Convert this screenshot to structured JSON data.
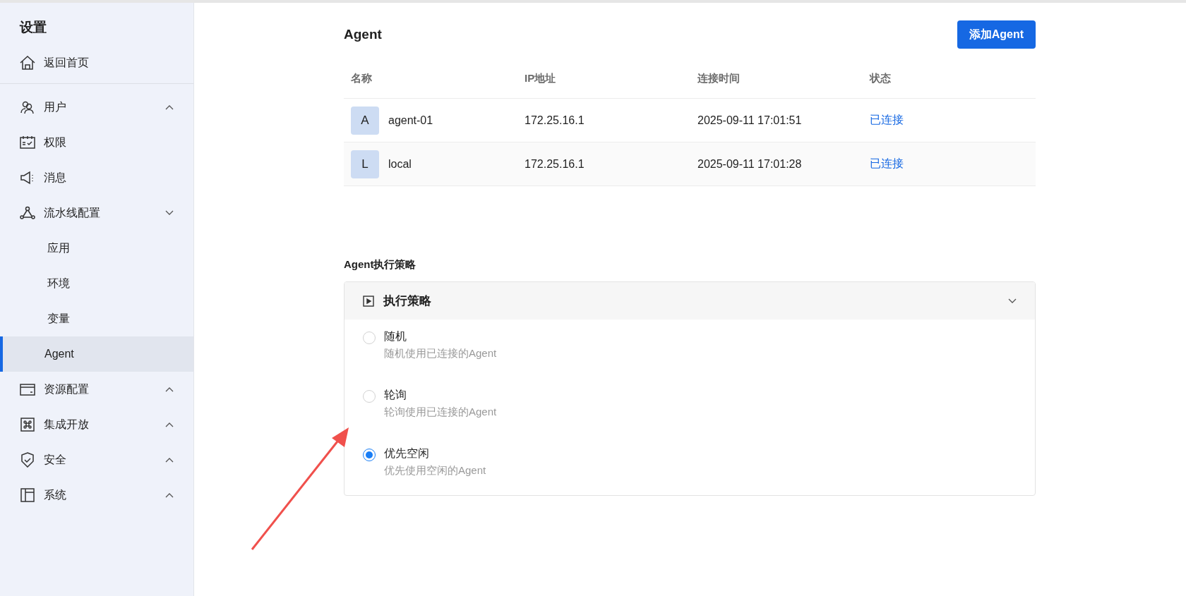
{
  "sidebar": {
    "title": "设置",
    "home": "返回首页",
    "items": [
      {
        "label": "用户",
        "expanded": false
      },
      {
        "label": "权限"
      },
      {
        "label": "消息"
      },
      {
        "label": "流水线配置",
        "expanded": true,
        "children": [
          {
            "label": "应用",
            "selected": false
          },
          {
            "label": "环境",
            "selected": false
          },
          {
            "label": "变量",
            "selected": false
          },
          {
            "label": "Agent",
            "selected": true
          }
        ]
      },
      {
        "label": "资源配置",
        "expanded": false
      },
      {
        "label": "集成开放",
        "expanded": false
      },
      {
        "label": "安全",
        "expanded": false
      },
      {
        "label": "系统",
        "expanded": false
      }
    ]
  },
  "agents": {
    "title": "Agent",
    "add_button": "添加Agent",
    "columns": [
      "名称",
      "IP地址",
      "连接时间",
      "状态"
    ],
    "rows": [
      {
        "avatar": "A",
        "name": "agent-01",
        "ip": "172.25.16.1",
        "time": "2025-09-11 17:01:51",
        "status": "已连接"
      },
      {
        "avatar": "L",
        "name": "local",
        "ip": "172.25.16.1",
        "time": "2025-09-11 17:01:28",
        "status": "已连接"
      }
    ]
  },
  "strategy": {
    "title": "Agent执行策略",
    "panel_title": "执行策略",
    "expanded": true,
    "options": [
      {
        "label": "随机",
        "description": "随机使用已连接的Agent",
        "selected": false
      },
      {
        "label": "轮询",
        "description": "轮询使用已连接的Agent",
        "selected": false
      },
      {
        "label": "优先空闲",
        "description": "优先使用空闲的Agent",
        "selected": true
      }
    ]
  }
}
